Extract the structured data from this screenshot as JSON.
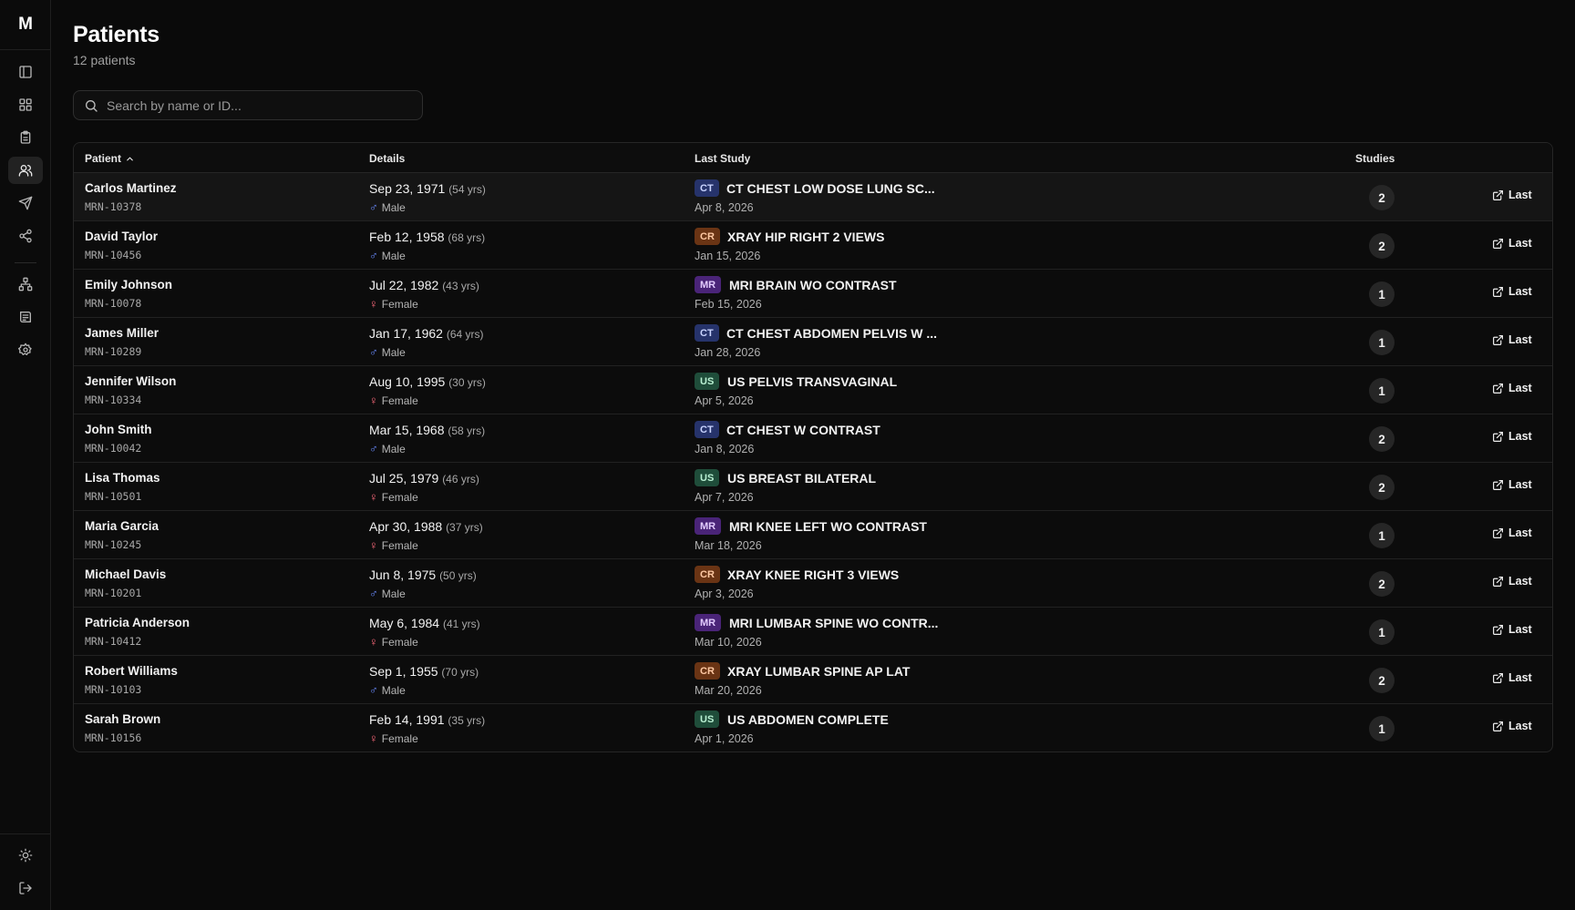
{
  "app": {
    "logo_text": "M"
  },
  "sidebar": {
    "items": [
      {
        "icon": "panel-icon",
        "label": "Toggle sidebar"
      },
      {
        "icon": "dashboard-icon",
        "label": "Dashboard"
      },
      {
        "icon": "clipboard-icon",
        "label": "Worklist"
      },
      {
        "icon": "users-icon",
        "label": "Patients",
        "active": true
      },
      {
        "icon": "send-icon",
        "label": "Send"
      },
      {
        "icon": "share-icon",
        "label": "Share"
      },
      {
        "icon": "hierarchy-icon",
        "label": "Organization"
      },
      {
        "icon": "templates-icon",
        "label": "Templates"
      },
      {
        "icon": "gear-icon",
        "label": "Settings"
      }
    ],
    "bottom": [
      {
        "icon": "sun-icon",
        "label": "Theme"
      },
      {
        "icon": "logout-icon",
        "label": "Log out"
      }
    ]
  },
  "page": {
    "title": "Patients",
    "subtitle": "12 patients"
  },
  "search": {
    "placeholder": "Search by name or ID..."
  },
  "table": {
    "columns": {
      "patient": "Patient",
      "details": "Details",
      "last_study": "Last Study",
      "studies": "Studies"
    },
    "sort": {
      "column": "patient",
      "direction": "asc"
    },
    "action_label": "Last",
    "modality_colors": {
      "CT": {
        "bg": "#26336b",
        "fg": "#c9d4ff"
      },
      "CR": {
        "bg": "#6a3414",
        "fg": "#ffc9a3"
      },
      "MR": {
        "bg": "#4a2478",
        "fg": "#e3ccff"
      },
      "US": {
        "bg": "#1f4d3a",
        "fg": "#b8f0d2"
      }
    },
    "rows": [
      {
        "name": "Carlos Martinez",
        "mrn": "MRN-10378",
        "dob": "Sep 23, 1971",
        "age": "(54 yrs)",
        "sex": "Male",
        "modality": "CT",
        "study": "CT CHEST LOW DOSE LUNG SC...",
        "study_date": "Apr 8, 2026",
        "studies": "2"
      },
      {
        "name": "David Taylor",
        "mrn": "MRN-10456",
        "dob": "Feb 12, 1958",
        "age": "(68 yrs)",
        "sex": "Male",
        "modality": "CR",
        "study": "XRAY HIP RIGHT 2 VIEWS",
        "study_date": "Jan 15, 2026",
        "studies": "2"
      },
      {
        "name": "Emily Johnson",
        "mrn": "MRN-10078",
        "dob": "Jul 22, 1982",
        "age": "(43 yrs)",
        "sex": "Female",
        "modality": "MR",
        "study": "MRI BRAIN WO CONTRAST",
        "study_date": "Feb 15, 2026",
        "studies": "1"
      },
      {
        "name": "James Miller",
        "mrn": "MRN-10289",
        "dob": "Jan 17, 1962",
        "age": "(64 yrs)",
        "sex": "Male",
        "modality": "CT",
        "study": "CT CHEST ABDOMEN PELVIS W ...",
        "study_date": "Jan 28, 2026",
        "studies": "1"
      },
      {
        "name": "Jennifer Wilson",
        "mrn": "MRN-10334",
        "dob": "Aug 10, 1995",
        "age": "(30 yrs)",
        "sex": "Female",
        "modality": "US",
        "study": "US PELVIS TRANSVAGINAL",
        "study_date": "Apr 5, 2026",
        "studies": "1"
      },
      {
        "name": "John Smith",
        "mrn": "MRN-10042",
        "dob": "Mar 15, 1968",
        "age": "(58 yrs)",
        "sex": "Male",
        "modality": "CT",
        "study": "CT CHEST W CONTRAST",
        "study_date": "Jan 8, 2026",
        "studies": "2"
      },
      {
        "name": "Lisa Thomas",
        "mrn": "MRN-10501",
        "dob": "Jul 25, 1979",
        "age": "(46 yrs)",
        "sex": "Female",
        "modality": "US",
        "study": "US BREAST BILATERAL",
        "study_date": "Apr 7, 2026",
        "studies": "2"
      },
      {
        "name": "Maria Garcia",
        "mrn": "MRN-10245",
        "dob": "Apr 30, 1988",
        "age": "(37 yrs)",
        "sex": "Female",
        "modality": "MR",
        "study": "MRI KNEE LEFT WO CONTRAST",
        "study_date": "Mar 18, 2026",
        "studies": "1"
      },
      {
        "name": "Michael Davis",
        "mrn": "MRN-10201",
        "dob": "Jun 8, 1975",
        "age": "(50 yrs)",
        "sex": "Male",
        "modality": "CR",
        "study": "XRAY KNEE RIGHT 3 VIEWS",
        "study_date": "Apr 3, 2026",
        "studies": "2"
      },
      {
        "name": "Patricia Anderson",
        "mrn": "MRN-10412",
        "dob": "May 6, 1984",
        "age": "(41 yrs)",
        "sex": "Female",
        "modality": "MR",
        "study": "MRI LUMBAR SPINE WO CONTR...",
        "study_date": "Mar 10, 2026",
        "studies": "1"
      },
      {
        "name": "Robert Williams",
        "mrn": "MRN-10103",
        "dob": "Sep 1, 1955",
        "age": "(70 yrs)",
        "sex": "Male",
        "modality": "CR",
        "study": "XRAY LUMBAR SPINE AP LAT",
        "study_date": "Mar 20, 2026",
        "studies": "2"
      },
      {
        "name": "Sarah Brown",
        "mrn": "MRN-10156",
        "dob": "Feb 14, 1991",
        "age": "(35 yrs)",
        "sex": "Female",
        "modality": "US",
        "study": "US ABDOMEN COMPLETE",
        "study_date": "Apr 1, 2026",
        "studies": "1"
      }
    ]
  },
  "colors": {
    "background": "#0a0a0a",
    "male": "#6b8cff",
    "female": "#ff6b7d"
  }
}
